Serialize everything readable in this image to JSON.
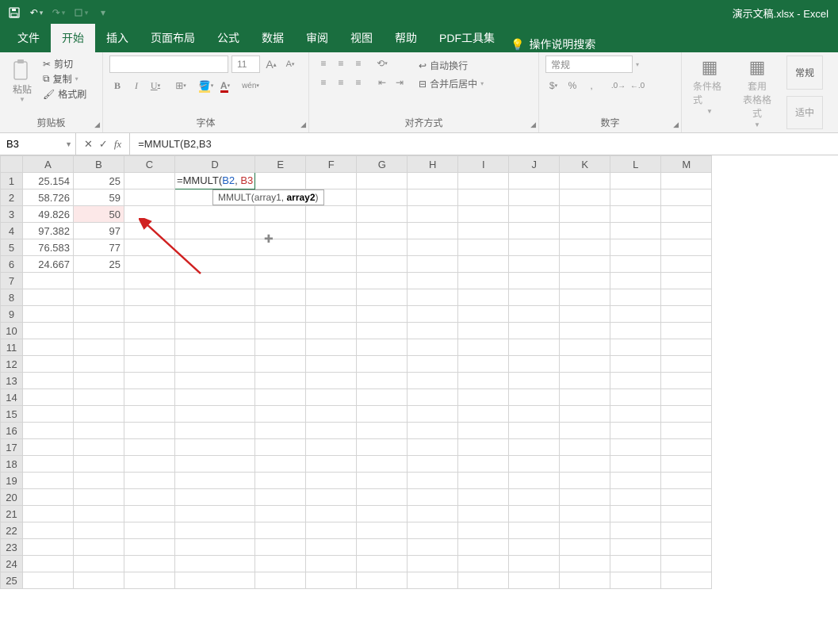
{
  "title": "演示文稿.xlsx  -  Excel",
  "tabs": {
    "file": "文件",
    "home": "开始",
    "insert": "插入",
    "layout": "页面布局",
    "formula": "公式",
    "data": "数据",
    "review": "审阅",
    "view": "视图",
    "help": "帮助",
    "pdf": "PDF工具集",
    "search": "操作说明搜索"
  },
  "groups": {
    "clipboard": "剪贴板",
    "font": "字体",
    "align": "对齐方式",
    "number": "数字"
  },
  "clip": {
    "paste": "粘贴",
    "cut": "剪切",
    "copy": "复制",
    "format": "格式刷"
  },
  "fontbox": {
    "name": "",
    "size": "11"
  },
  "alignopts": {
    "wrap": "自动换行",
    "merge": "合并后居中"
  },
  "numfmt": "常规",
  "styles": {
    "cond": "条件格式",
    "table": "套用\n表格格式",
    "normal": "常规",
    "good": "适中"
  },
  "namebox": "B3",
  "formula": "=MMULT(B2,B3",
  "formula_parts": {
    "eq": "=",
    "fn": "MMULT",
    "lp": "(",
    "a1": "B2",
    "comma": ",",
    "sp": " ",
    "a2": "B3"
  },
  "tooltip": {
    "fn": "MMULT(",
    "a1": "array1",
    "sep": ", ",
    "a2": "array2",
    "rp": ")"
  },
  "columns": [
    "A",
    "B",
    "C",
    "D",
    "E",
    "F",
    "G",
    "H",
    "I",
    "J",
    "K",
    "L",
    "M"
  ],
  "rows": [
    1,
    2,
    3,
    4,
    5,
    6,
    7,
    8,
    9,
    10,
    11,
    12,
    13,
    14,
    15,
    16,
    17,
    18,
    19,
    20,
    21,
    22,
    23,
    24,
    25
  ],
  "cells": {
    "A1": "25.154",
    "B1": "25",
    "A2": "58.726",
    "B2": "59",
    "A3": "49.826",
    "B3": "50",
    "A4": "97.382",
    "B4": "97",
    "A5": "76.583",
    "B5": "77",
    "A6": "24.667",
    "B6": "25"
  }
}
